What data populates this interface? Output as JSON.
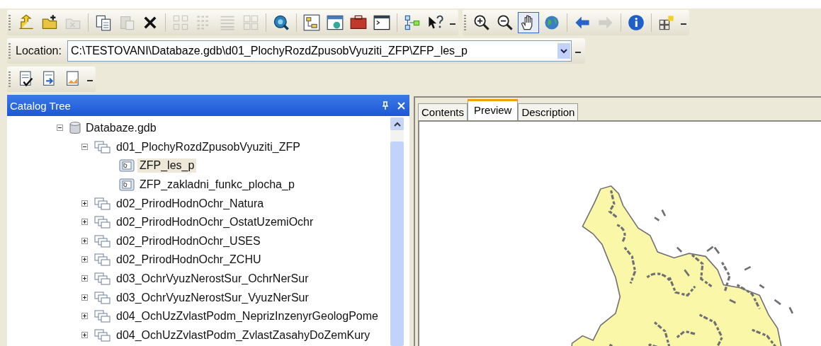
{
  "toolbar_main": [
    {
      "kind": "up",
      "disabled": false,
      "selected": false
    },
    {
      "kind": "connect",
      "disabled": false,
      "selected": false
    },
    {
      "kind": "disconnect",
      "disabled": true,
      "selected": false
    },
    {
      "kind": "sep"
    },
    {
      "kind": "copy",
      "disabled": false,
      "selected": false
    },
    {
      "kind": "paste",
      "disabled": true,
      "selected": false
    },
    {
      "kind": "delete",
      "disabled": false,
      "selected": false
    },
    {
      "kind": "sep"
    },
    {
      "kind": "large",
      "disabled": true,
      "selected": false
    },
    {
      "kind": "list",
      "disabled": true,
      "selected": false
    },
    {
      "kind": "details",
      "disabled": true,
      "selected": false
    },
    {
      "kind": "thumbs",
      "disabled": true,
      "selected": false
    },
    {
      "kind": "sep"
    },
    {
      "kind": "search",
      "disabled": false,
      "selected": false
    },
    {
      "kind": "sep"
    },
    {
      "kind": "catalog",
      "disabled": false,
      "selected": false
    },
    {
      "kind": "window",
      "disabled": false,
      "selected": false
    },
    {
      "kind": "toolbox",
      "disabled": false,
      "selected": false
    },
    {
      "kind": "command",
      "disabled": false,
      "selected": false
    },
    {
      "kind": "sep"
    },
    {
      "kind": "model",
      "disabled": false,
      "selected": false
    },
    {
      "kind": "help",
      "disabled": false,
      "selected": false
    }
  ],
  "toolbar_geo": [
    {
      "kind": "zoomin",
      "disabled": false,
      "selected": false
    },
    {
      "kind": "zoomout",
      "disabled": false,
      "selected": false
    },
    {
      "kind": "pan",
      "disabled": false,
      "selected": true
    },
    {
      "kind": "globe",
      "disabled": false,
      "selected": false
    },
    {
      "kind": "sep"
    },
    {
      "kind": "back",
      "disabled": false,
      "selected": false
    },
    {
      "kind": "forward",
      "disabled": true,
      "selected": false
    },
    {
      "kind": "sep"
    },
    {
      "kind": "identify",
      "disabled": false,
      "selected": false
    },
    {
      "kind": "sep"
    },
    {
      "kind": "thumbnail",
      "disabled": false,
      "selected": false
    }
  ],
  "location": {
    "label": "Location:",
    "value": "C:\\TESTOVANI\\Databaze.gdb\\d01_PlochyRozdZpusobVyuziti_ZFP\\ZFP_les_p"
  },
  "toolbar_metadata": [
    {
      "kind": "edit"
    },
    {
      "kind": "import"
    },
    {
      "kind": "export"
    }
  ],
  "catalog_tree": {
    "title": "Catalog Tree",
    "items": [
      {
        "label": "Databaze.gdb",
        "kind": "database",
        "expanded": true,
        "selected": false,
        "children": [
          {
            "label": "d01_PlochyRozdZpusobVyuziti_ZFP",
            "kind": "dataset",
            "expanded": true,
            "selected": false,
            "children": [
              {
                "label": "ZFP_les_p",
                "kind": "featureclass",
                "selected": true
              },
              {
                "label": "ZFP_zakladni_funkc_plocha_p",
                "kind": "featureclass",
                "selected": false
              }
            ]
          },
          {
            "label": "d02_PrirodHodnOchr_Natura",
            "kind": "dataset",
            "expanded": false,
            "selected": false
          },
          {
            "label": "d02_PrirodHodnOchr_OstatUzemiOchr",
            "kind": "dataset",
            "expanded": false,
            "selected": false
          },
          {
            "label": "d02_PrirodHodnOchr_USES",
            "kind": "dataset",
            "expanded": false,
            "selected": false
          },
          {
            "label": "d02_PrirodHodnOchr_ZCHU",
            "kind": "dataset",
            "expanded": false,
            "selected": false
          },
          {
            "label": "d03_OchrVyuzNerostSur_OchrNerSur",
            "kind": "dataset",
            "expanded": false,
            "selected": false
          },
          {
            "label": "d03_OchrVyuzNerostSur_VyuzNerSur",
            "kind": "dataset",
            "expanded": false,
            "selected": false
          },
          {
            "label": "d04_OchUzZvlastPodm_NeprizInzenyrGeologPome",
            "kind": "dataset",
            "expanded": false,
            "selected": false
          },
          {
            "label": "d04_OchUzZvlastPodm_ZvlastZasahyDoZemKury",
            "kind": "dataset",
            "expanded": false,
            "selected": false
          }
        ]
      }
    ]
  },
  "tabs": [
    {
      "label": "Contents",
      "selected": false
    },
    {
      "label": "Preview",
      "selected": true
    },
    {
      "label": "Description",
      "selected": false
    }
  ]
}
